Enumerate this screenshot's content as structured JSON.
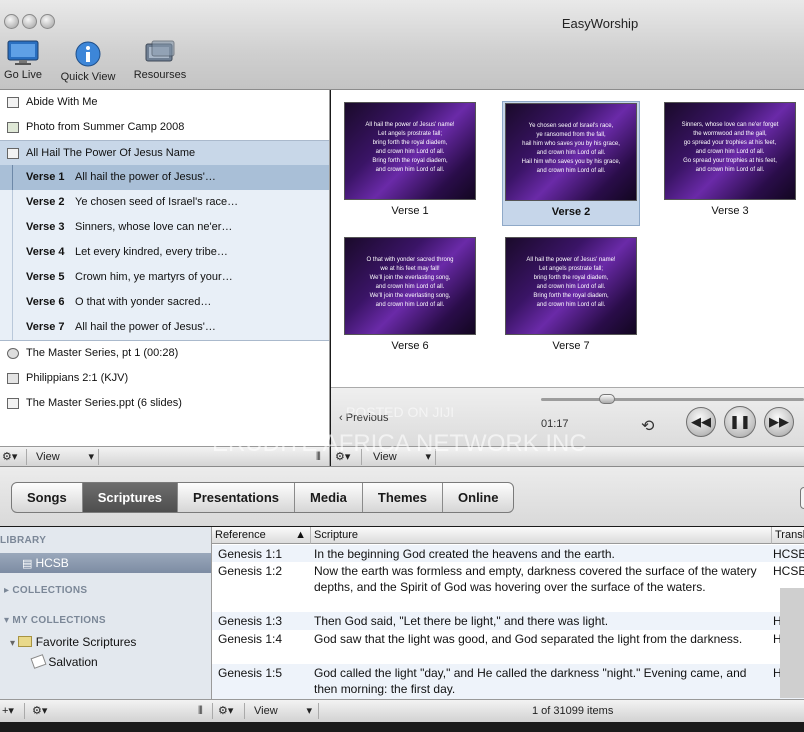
{
  "app": {
    "title": "EasyWorship"
  },
  "toolbar": {
    "go_live": "Go Live",
    "quick_view": "Quick View",
    "resources": "Resourses"
  },
  "service": {
    "items": [
      {
        "label": "Abide With Me",
        "icon": "song-icon"
      },
      {
        "label": "Photo from Summer Camp 2008",
        "icon": "photo-icon"
      }
    ],
    "selected_song": "All Hail The Power Of Jesus Name",
    "verses": [
      {
        "num": "Verse 1",
        "text": "All hail the power of Jesus'…"
      },
      {
        "num": "Verse 2",
        "text": "Ye chosen seed of Israel's race…"
      },
      {
        "num": "Verse 3",
        "text": "Sinners, whose love can ne'er…"
      },
      {
        "num": "Verse 4",
        "text": "Let every kindred, every tribe…"
      },
      {
        "num": "Verse 5",
        "text": "Crown him, ye martyrs of your…"
      },
      {
        "num": "Verse 6",
        "text": "O that with yonder sacred…"
      },
      {
        "num": "Verse 7",
        "text": "All hail the power of Jesus'…"
      }
    ],
    "after": [
      {
        "label": "The Master Series, pt 1   (00:28)",
        "icon": "dvd-icon"
      },
      {
        "label": "Philippians 2:1   (KJV)",
        "icon": "scripture-icon"
      },
      {
        "label": "The Master Series.ppt   (6 slides)",
        "icon": "presentation-icon"
      }
    ]
  },
  "footer": {
    "view": "View"
  },
  "slides": [
    {
      "label": "Verse 1",
      "lines": [
        "All hail the power of Jesus' name!",
        "Let angels prostrate fall;",
        "bring forth the royal diadem,",
        "and crown him Lord of all.",
        "Bring forth the royal diadem,",
        "and crown him Lord of all."
      ]
    },
    {
      "label": "Verse 2",
      "lines": [
        "Ye chosen seed of Israel's race,",
        "ye ransomed from the fall,",
        "hail him who saves you by his grace,",
        "and crown him Lord of all.",
        "Hail him who saves you by his grace,",
        "and crown him Lord of all."
      ]
    },
    {
      "label": "Verse 3",
      "lines": [
        "Sinners, whose love can ne'er forget",
        "the wormwood and the gall,",
        "go spread your trophies at his feet,",
        "and crown him Lord of all.",
        "Go spread your trophies at his feet,",
        "and crown him Lord of all."
      ]
    },
    {
      "label": "Verse 6",
      "lines": [
        "O that with yonder sacred throng",
        "we at his feet may fall!",
        "We'll join the everlasting song,",
        "and crown him Lord of all.",
        "We'll join the everlasting song,",
        "and crown him Lord of all."
      ]
    },
    {
      "label": "Verse 7",
      "lines": [
        "All hail the power of Jesus' name!",
        "Let angels prostrate fall;",
        "bring forth the royal diadem,",
        "and crown him Lord of all.",
        "Bring forth the royal diadem,",
        "and crown him Lord of all."
      ]
    }
  ],
  "transport": {
    "previous": "Previous",
    "time": "01:17",
    "progress": 0.25
  },
  "tabs": [
    "Songs",
    "Scriptures",
    "Presentations",
    "Media",
    "Themes",
    "Online"
  ],
  "active_tab": "Scriptures",
  "library": {
    "library_head": "LIBRARY",
    "version": "HCSB",
    "collections_head": "COLLECTIONS",
    "my_collections_head": "MY COLLECTIONS",
    "favorite": "Favorite Scriptures",
    "salvation": "Salvation"
  },
  "table": {
    "headers": {
      "reference": "Reference",
      "scripture": "Scripture",
      "translation": "Transl"
    },
    "rows": [
      {
        "ref": "Genesis 1:1",
        "text": "In the beginning God created the heavens and the earth.",
        "trans": "HCSB"
      },
      {
        "ref": "Genesis 1:2",
        "text": "Now the earth was formless and empty, darkness covered the surface of the watery depths, and the Spirit of God was hovering over the surface of the waters.",
        "trans": "HCSB"
      },
      {
        "ref": "Genesis 1:3",
        "text": "Then God said, \"Let there be light,\" and there was light.",
        "trans": "HCSB"
      },
      {
        "ref": "Genesis 1:4",
        "text": "God saw that the light was good, and God separated the light from the darkness.",
        "trans": "HCSB"
      },
      {
        "ref": "Genesis 1:5",
        "text": "God called the light \"day,\" and He called the darkness \"night.\" Evening came, and then morning: the first day.",
        "trans": "HCSB"
      }
    ],
    "count": "1 of 31099 items"
  },
  "watermark": {
    "line1": "POSTED ON JIJI",
    "line2": "ERUDITE AFRICA NETWORK INC"
  }
}
